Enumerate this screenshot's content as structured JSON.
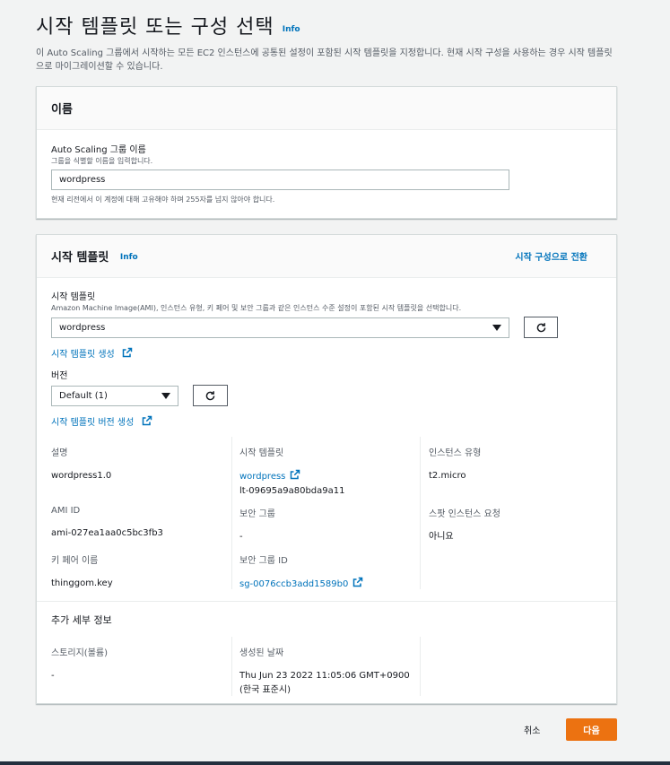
{
  "page": {
    "title": "시작 템플릿 또는 구성 선택",
    "info": "Info",
    "description": "이 Auto Scaling 그룹에서 시작하는 모든 EC2 인스턴스에 공통된 설정이 포함된 시작 템플릿을 지정합니다. 현재 시작 구성을 사용하는 경우 시작 템플릿으로 마이그레이션할 수 있습니다."
  },
  "name_panel": {
    "title": "이름",
    "field_label": "Auto Scaling 그룹 이름",
    "field_sublabel": "그룹을 식별할 이름을 입력합니다.",
    "field_value": "wordpress",
    "field_hint": "현재 리전에서 이 계정에 대해 고유해야 하며 255자를 넘지 않아야 합니다."
  },
  "template_panel": {
    "title": "시작 템플릿",
    "info": "Info",
    "switch_link": "시작 구성으로 전환",
    "template_label": "시작 템플릿",
    "template_sublabel": "Amazon Machine Image(AMI), 인스턴스 유형, 키 페어 및 보안 그룹과 같은 인스턴스 수준 설정이 포함된 시작 템플릿을 선택합니다.",
    "template_value": "wordpress",
    "create_template_link": "시작 템플릿 생성",
    "version_label": "버전",
    "version_value": "Default (1)",
    "create_version_link": "시작 템플릿 버전 생성",
    "details": {
      "description_label": "설명",
      "description_value": "wordpress1.0",
      "template_label": "시작 템플릿",
      "template_link": "wordpress",
      "template_id": "lt-09695a9a80bda9a11",
      "instance_type_label": "인스턴스 유형",
      "instance_type_value": "t2.micro",
      "ami_label": "AMI ID",
      "ami_value": "ami-027ea1aa0c5bc3fb3",
      "sg_label": "보안 그룹",
      "sg_value": "-",
      "spot_label": "스팟 인스턴스 요청",
      "spot_value": "아니요",
      "keypair_label": "키 페어 이름",
      "keypair_value": "thinggom.key",
      "sgid_label": "보안 그룹 ID",
      "sgid_value": "sg-0076ccb3add1589b0"
    },
    "additional": {
      "title": "추가 세부 정보",
      "storage_label": "스토리지(볼륨)",
      "storage_value": "-",
      "created_label": "생성된 날짜",
      "created_value_line1": "Thu Jun 23 2022 11:05:06 GMT+0900",
      "created_value_line2": "(한국 표준시)"
    }
  },
  "footer": {
    "cancel": "취소",
    "next": "다음"
  },
  "colors": {
    "link": "#0073bb",
    "primary": "#ec7211",
    "background": "#f2f3f3"
  }
}
